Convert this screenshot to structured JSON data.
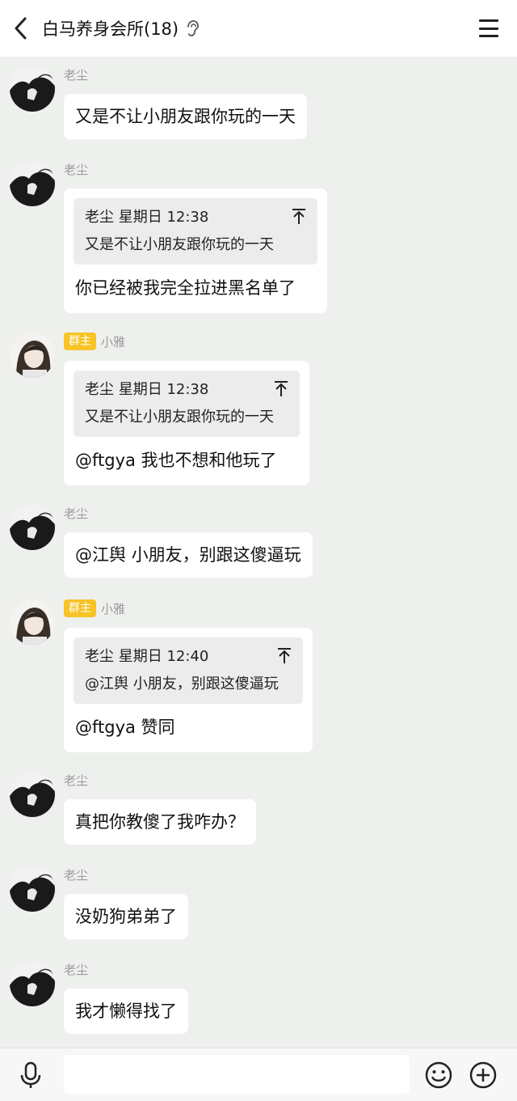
{
  "header": {
    "title": "白马养身会所(18)",
    "back_icon": "chevron-left-icon",
    "ear_icon": "ear-icon",
    "menu_icon": "hamburger-menu-icon"
  },
  "messages": [
    {
      "sender": "老尘",
      "badge": "",
      "text": "又是不让小朋友跟你玩的一天"
    },
    {
      "sender": "老尘",
      "badge": "",
      "quote_meta": "老尘 星期日 12:38",
      "quote_text": "又是不让小朋友跟你玩的一天",
      "text": "你已经被我完全拉进黑名单了"
    },
    {
      "sender": "小雅",
      "badge": "群主",
      "quote_meta": "老尘 星期日 12:38",
      "quote_text": "又是不让小朋友跟你玩的一天",
      "text": "@ftgya 我也不想和他玩了"
    },
    {
      "sender": "老尘",
      "badge": "",
      "text": "@江舆 小朋友，别跟这傻逼玩"
    },
    {
      "sender": "小雅",
      "badge": "群主",
      "quote_meta": "老尘 星期日 12:40",
      "quote_text": "@江舆 小朋友，别跟这傻逼玩",
      "text": "@ftgya 赞同"
    },
    {
      "sender": "老尘",
      "badge": "",
      "text": "真把你教傻了我咋办？"
    },
    {
      "sender": "老尘",
      "badge": "",
      "text": "没奶狗弟弟了"
    },
    {
      "sender": "老尘",
      "badge": "",
      "text": "我才懒得找了"
    }
  ],
  "input_bar": {
    "placeholder": "",
    "mic_icon": "microphone-icon",
    "emoji_icon": "emoji-icon",
    "plus_icon": "plus-circle-icon"
  },
  "colors": {
    "background": "#edf0ed",
    "bubble": "#ffffff",
    "quote_bg": "#ececec",
    "badge": "#f7c325",
    "sender_name": "#9a9a9a"
  }
}
